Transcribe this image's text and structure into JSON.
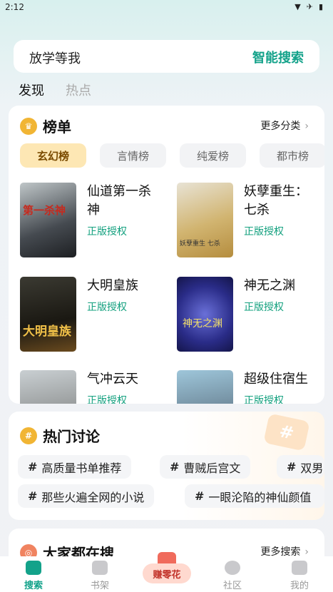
{
  "status": {
    "time": "2:12"
  },
  "search": {
    "query": "放学等我",
    "button": "智能搜索"
  },
  "tabs": [
    "发现",
    "热点"
  ],
  "ranking": {
    "title": "榜单",
    "more": "更多分类",
    "chips": [
      "玄幻榜",
      "言情榜",
      "纯爱榜",
      "都市榜"
    ],
    "books": [
      {
        "title": "仙道第一杀神",
        "tag": "正版授权",
        "cover_text": "第一杀神"
      },
      {
        "title": "妖孽重生：七杀",
        "tag": "正版授权",
        "cover_text": "妖孽重生 七杀"
      },
      {
        "title": "大明皇族",
        "tag": "正版授权",
        "cover_text": "大明皇族"
      },
      {
        "title": "神无之渊",
        "tag": "正版授权",
        "cover_text": "神无之渊"
      },
      {
        "title": "气冲云天",
        "tag": "正版授权",
        "cover_text": ""
      },
      {
        "title": "超级住宿生",
        "tag": "正版授权",
        "cover_text": ""
      }
    ]
  },
  "discussion": {
    "title": "热门讨论",
    "tags": [
      "高质量书单推荐",
      "曹贼后宫文",
      "双男",
      "那些火遍全网的小说",
      "一眼沦陷的神仙颜值"
    ]
  },
  "popular": {
    "title": "大家都在搜",
    "more": "更多搜索"
  },
  "nav": {
    "items": [
      "搜索",
      "书架",
      "赚零花",
      "社区",
      "我的"
    ]
  },
  "colors": {
    "accent": "#13a28a",
    "chip_active": "#fde7b4"
  }
}
